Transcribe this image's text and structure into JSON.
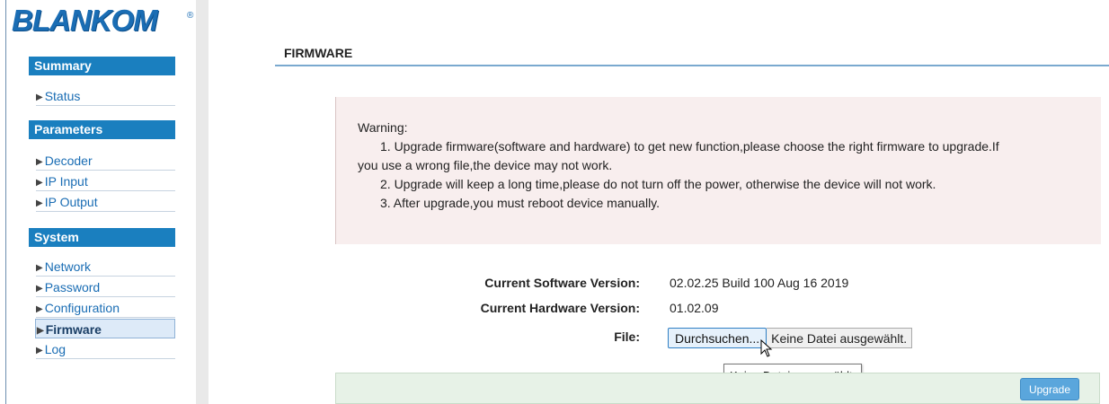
{
  "sidebar": {
    "logo": "BLANKOM",
    "logo_mark": "®",
    "sections": [
      {
        "title": "Summary",
        "items": [
          {
            "label": "Status"
          }
        ]
      },
      {
        "title": "Parameters",
        "items": [
          {
            "label": "Decoder"
          },
          {
            "label": "IP Input"
          },
          {
            "label": "IP Output"
          }
        ]
      },
      {
        "title": "System",
        "items": [
          {
            "label": "Network"
          },
          {
            "label": "Password"
          },
          {
            "label": "Configuration"
          },
          {
            "label": "Firmware"
          },
          {
            "label": "Log"
          }
        ]
      }
    ],
    "active_item": "Firmware",
    "bullet_icon": "triangle-right-icon"
  },
  "main": {
    "title": "FIRMWARE",
    "warning": {
      "title": "Warning:",
      "lines": [
        "1. Upgrade firmware(software and hardware) to get new function,please choose the right firmware to upgrade.If",
        "you use a wrong file,the device may not work.",
        "2. Upgrade will keep a long time,please do not turn off the power, otherwise the device will not work.",
        "3. After upgrade,you must reboot device manually."
      ]
    },
    "info": {
      "software_label": "Current Software Version:",
      "software_value": "02.02.25 Build 100 Aug 16 2019",
      "hardware_label": "Current Hardware Version:",
      "hardware_value": "01.02.09",
      "file_label": "File:"
    },
    "file_input": {
      "button_label": "Durchsuchen...",
      "status": "Keine Datei ausgewählt."
    },
    "tooltip": "Keine Datei ausgewählt.",
    "upgrade_label": "Upgrade"
  },
  "colors": {
    "accent": "#1a7fbf",
    "link": "#1a6db4",
    "warning_bg": "#f8eeee",
    "action_bg": "#e7f2e7",
    "button": "#5aa6dc"
  }
}
